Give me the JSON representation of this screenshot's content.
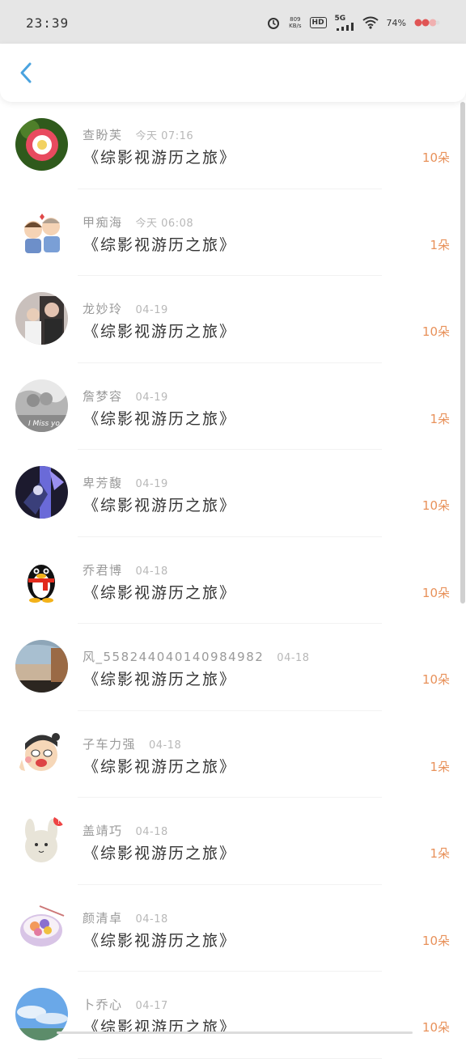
{
  "status_bar": {
    "time": "23:39",
    "net_speed": "809\nKB/s",
    "hd": "HD",
    "network": "5G",
    "battery": "74%"
  },
  "header": {
    "back_icon": "chevron-left-icon"
  },
  "colors": {
    "accent": "#e8915a",
    "back": "#4aa3df"
  },
  "gifts": [
    {
      "name": "查盼芙",
      "date": "今天 07:16",
      "book": "《综影视游历之旅》",
      "amount": "10朵",
      "avatar": "rose-photo"
    },
    {
      "name": "甲痴海",
      "date": "今天 06:08",
      "book": "《综影视游历之旅》",
      "amount": "1朵",
      "avatar": "cartoon-couple"
    },
    {
      "name": "龙妙玲",
      "date": "04-19",
      "book": "《综影视游历之旅》",
      "amount": "10朵",
      "avatar": "couple-photo"
    },
    {
      "name": "詹梦容",
      "date": "04-19",
      "book": "《综影视游历之旅》",
      "amount": "1朵",
      "avatar": "miss-you-photo"
    },
    {
      "name": "卑芳馥",
      "date": "04-19",
      "book": "《综影视游历之旅》",
      "amount": "10朵",
      "avatar": "anime-dark"
    },
    {
      "name": "乔君博",
      "date": "04-18",
      "book": "《综影视游历之旅》",
      "amount": "10朵",
      "avatar": "qq-penguin"
    },
    {
      "name": "风_558244040140984982",
      "date": "04-18",
      "book": "《综影视游历之旅》",
      "amount": "10朵",
      "avatar": "landscape-photo"
    },
    {
      "name": "子车力强",
      "date": "04-18",
      "book": "《综影视游历之旅》",
      "amount": "1朵",
      "avatar": "cartoon-man"
    },
    {
      "name": "盖靖巧",
      "date": "04-18",
      "book": "《综影视游历之旅》",
      "amount": "1朵",
      "avatar": "cartoon-rabbit"
    },
    {
      "name": "颜清卓",
      "date": "04-18",
      "book": "《综影视游历之旅》",
      "amount": "10朵",
      "avatar": "food-bowl"
    },
    {
      "name": "卜乔心",
      "date": "04-17",
      "book": "《综影视游历之旅》",
      "amount": "10朵",
      "avatar": "sky-photo"
    }
  ]
}
